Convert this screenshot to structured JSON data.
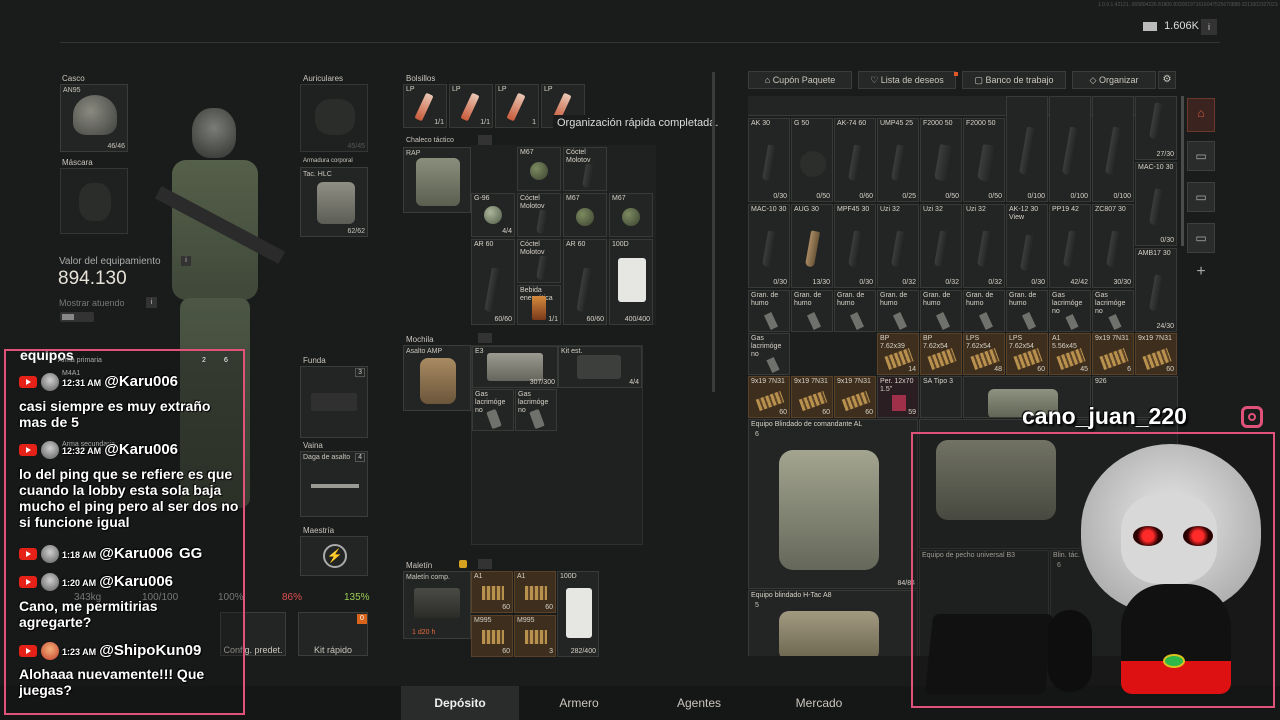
{
  "topbar": {
    "version": "1.0.0.1.42121.-365804236.81800.833001971616047525670888-3211002327021040-11691090811404",
    "money": "1.606K",
    "info_icon": "i"
  },
  "left": {
    "helmet": {
      "label": "Casco",
      "item": "AN95",
      "count": "46/46"
    },
    "mask": {
      "label": "Máscara"
    },
    "headset": {
      "label": "Auriculares",
      "count": "45/45"
    },
    "armor": {
      "label": "Armadura corporal",
      "item": "Tac. HLC",
      "count": "62/62"
    },
    "value_label": "Valor del equipamiento",
    "value": "894.130",
    "show_label": "Mostrar atuendo",
    "primary": {
      "label": "Arma primaria",
      "item": "M4A1"
    },
    "secondary": {
      "label": "Arma secundaria"
    },
    "holster": {
      "label": "Funda"
    },
    "sheath": {
      "label": "Vaina",
      "item": "Daga de asalto"
    },
    "mastery": {
      "label": "Maestría"
    },
    "stats": {
      "weight": "343kg",
      "durability": "100/100",
      "s1": "100%",
      "s2": "86%",
      "s3": "135%"
    },
    "buttons": {
      "preset": "Config. predet.",
      "quick": "Kit rápido"
    }
  },
  "pockets": {
    "label": "Bolsillos",
    "items": [
      {
        "name": "LP",
        "count": "1/1"
      },
      {
        "name": "LP",
        "count": "1/1"
      },
      {
        "name": "LP",
        "count": "1"
      },
      {
        "name": "LP",
        "count": ""
      }
    ]
  },
  "toast": "Organización rápida completada.",
  "vest": {
    "label": "Chaleco táctico",
    "item": "RAP",
    "cells": [
      {
        "n": "M67",
        "c": ""
      },
      {
        "n": "Cóctel\nMolotov",
        "c": ""
      },
      {
        "n": "G-96",
        "c": "4/4"
      },
      {
        "n": "Cóctel\nMolotov",
        "c": ""
      },
      {
        "n": "M67",
        "c": ""
      },
      {
        "n": "M67",
        "c": ""
      },
      {
        "n": "AR 60",
        "c": "60/60"
      },
      {
        "n": "Cóctel\nMolotov",
        "c": ""
      },
      {
        "n": "AR 60",
        "c": "60/60"
      },
      {
        "n": "100D",
        "c": "400/400"
      },
      {
        "n": "Bebida\nenergética",
        "c": "1/1"
      }
    ]
  },
  "backpack": {
    "label": "Mochila",
    "item": "Asalto AMP",
    "cells": [
      {
        "n": "E3",
        "c": "307/300"
      },
      {
        "n": "Kit est.",
        "c": "4/4"
      },
      {
        "n": "Gas\nlacrimóge\nno",
        "c": ""
      },
      {
        "n": "Gas\nlacrimóge\nno",
        "c": ""
      }
    ]
  },
  "case": {
    "label": "Maletín",
    "item": "Maletín comp.",
    "timer": "1 d20 h",
    "cells": [
      {
        "n": "A1",
        "c": "60"
      },
      {
        "n": "A1",
        "c": "60"
      },
      {
        "n": "100D",
        "c": ""
      },
      {
        "n": "M995",
        "c": "60"
      },
      {
        "n": "M995",
        "c": "3"
      },
      {
        "n": "",
        "c": "282/400"
      }
    ]
  },
  "stash": {
    "tabs": [
      {
        "label": "Cupón Paquete"
      },
      {
        "label": "Lista de deseos"
      },
      {
        "label": "Banco de trabajo"
      },
      {
        "label": "Organizar"
      }
    ],
    "row1": [
      {
        "n": "AK 30",
        "c": "0/30"
      },
      {
        "n": "G 50",
        "c": "0/50"
      },
      {
        "n": "AK-74 60",
        "c": "0/60"
      },
      {
        "n": "UMP45 25",
        "c": "0/25"
      },
      {
        "n": "F2000 50",
        "c": "0/50"
      },
      {
        "n": "F2000 50",
        "c": "0/50"
      },
      {
        "n": "",
        "c": "0/100"
      },
      {
        "n": "",
        "c": "0/100"
      },
      {
        "n": "",
        "c": "0/100"
      }
    ],
    "row1_right": [
      {
        "n": "",
        "c": "27/30"
      },
      {
        "n": "MAC-10 30",
        "c": "0/30"
      }
    ],
    "row2": [
      {
        "n": "MAC-10 30",
        "c": "0/30"
      },
      {
        "n": "AUG 30",
        "c": "13/30"
      },
      {
        "n": "MPF45 30",
        "c": "0/30"
      },
      {
        "n": "Uzi 32",
        "c": "0/32"
      },
      {
        "n": "Uzi 32",
        "c": "0/32"
      },
      {
        "n": "Uzi 32",
        "c": "0/32"
      },
      {
        "n": "AK-12 30\nView",
        "c": "0/30"
      },
      {
        "n": "PP19 42",
        "c": "42/42"
      },
      {
        "n": "ZC807 30",
        "c": "30/30"
      }
    ],
    "row2_right": [
      {
        "n": "AMB17 30",
        "c": "24/30"
      }
    ],
    "row3": [
      {
        "n": "Gran. de\nhumo",
        "c": ""
      },
      {
        "n": "Gran. de\nhumo",
        "c": ""
      },
      {
        "n": "Gran. de\nhumo",
        "c": ""
      },
      {
        "n": "Gran. de\nhumo",
        "c": ""
      },
      {
        "n": "Gran. de\nhumo",
        "c": ""
      },
      {
        "n": "Gran. de\nhumo",
        "c": ""
      },
      {
        "n": "Gran. de\nhumo",
        "c": ""
      },
      {
        "n": "Gas\nlacrimóge\nno",
        "c": ""
      },
      {
        "n": "Gas\nlacrimóge\nno",
        "c": ""
      }
    ],
    "row4_first": {
      "n": "Gas\nlacrimóge\nno",
      "c": ""
    },
    "row4": [
      {
        "n": "BP\n7.62x39",
        "c": "14"
      },
      {
        "n": "BP\n7.62x54",
        "c": ""
      },
      {
        "n": "LPS\n7.62x54",
        "c": "48"
      },
      {
        "n": "LPS\n7.62x54",
        "c": "60"
      },
      {
        "n": "A1\n5.56x45",
        "c": "45"
      },
      {
        "n": "9x19 7N31",
        "c": "6"
      },
      {
        "n": "9x19 7N31",
        "c": "60"
      }
    ],
    "row5": [
      {
        "n": "9x19 7N31",
        "c": "60"
      },
      {
        "n": "9x19 7N31",
        "c": "60"
      },
      {
        "n": "9x19 7N31",
        "c": "60"
      },
      {
        "n": "Per. 12x70\n1.5”",
        "c": "59"
      },
      {
        "n": "SA Tipo 3",
        "c": ""
      },
      {
        "n": "926",
        "c": ""
      }
    ],
    "big1": {
      "n": "Equipo Blindado de comandante AL",
      "c": "84/84",
      "lvl": "6"
    },
    "big2": {
      "n": "Equipo blindado H-Tac A8",
      "lvl": "5"
    },
    "big3": {
      "n": "Equipo de pecho universal B3"
    },
    "big4": {
      "n": "Blin. tác.",
      "lvl": "6"
    }
  },
  "bottom_tabs": [
    {
      "label": "Depósito"
    },
    {
      "label": "Armero"
    },
    {
      "label": "Agentes"
    },
    {
      "label": "Mercado"
    }
  ],
  "chat": {
    "top_fragment": "equipos",
    "messages": [
      {
        "time": "12:31 AM",
        "user": "@Karu006",
        "text": "casi siempre es muy extraño mas de 5"
      },
      {
        "time": "12:32 AM",
        "user": "@Karu006",
        "text": "lo del ping que se refiere es que cuando la lobby esta sola baja mucho el ping pero al ser dos no si funcione igual"
      },
      {
        "time": "1:18 AM",
        "user": "@Karu006",
        "text": "GG"
      },
      {
        "time": "1:20 AM",
        "user": "@Karu006",
        "text": "Cano, me permitirias agregarte?"
      },
      {
        "time": "1:23 AM",
        "user": "@ShipoKun09",
        "text": "Alohaaa nuevamente!!! Que juegas?"
      }
    ],
    "badge_count": "2",
    "badge_count2": "6"
  },
  "webcam": {
    "handle": "cano_juan_220"
  },
  "colors": {
    "accent": "#c0392b",
    "chat_border": "#e0527a",
    "stash_ammo": "#3d2e1d"
  }
}
